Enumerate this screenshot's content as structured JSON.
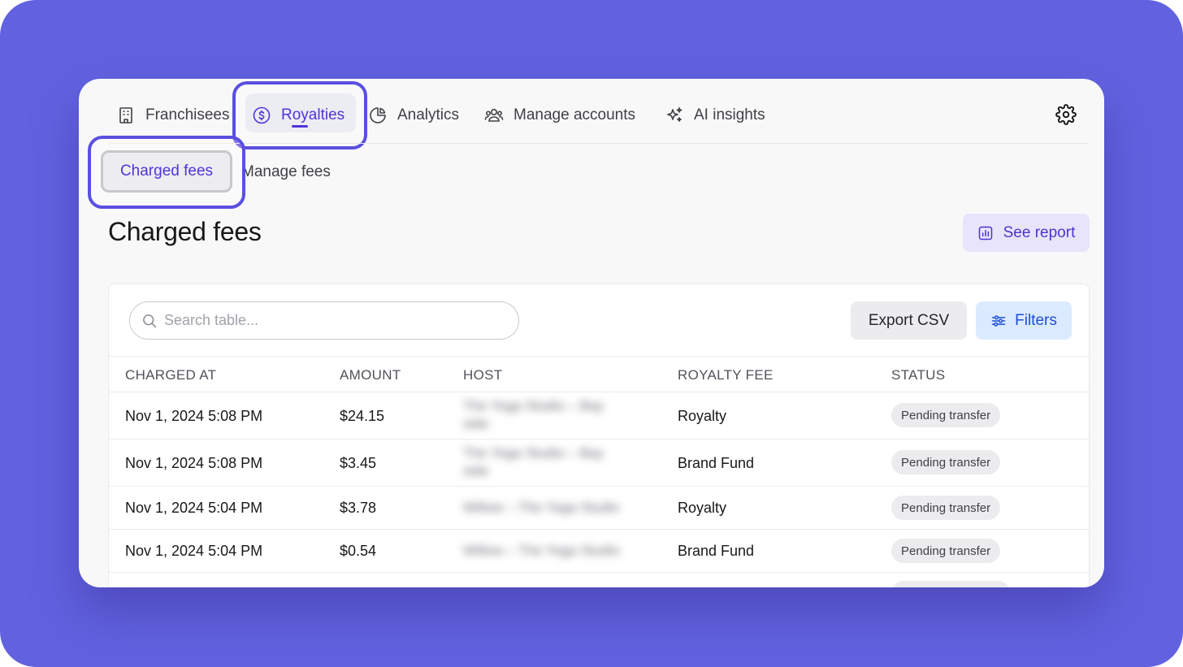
{
  "nav": {
    "items": [
      {
        "label": "Franchisees",
        "icon": "building-icon"
      },
      {
        "label": "Royalties",
        "icon": "dollar-circle-icon",
        "active": true
      },
      {
        "label": "Analytics",
        "icon": "pie-chart-icon"
      },
      {
        "label": "Manage accounts",
        "icon": "users-icon"
      },
      {
        "label": "AI insights",
        "icon": "sparkles-icon"
      }
    ],
    "settings_icon": "gear-icon"
  },
  "subnav": {
    "items": [
      {
        "label": "Charged fees",
        "active": true
      },
      {
        "label": "Manage fees"
      }
    ]
  },
  "page": {
    "title": "Charged fees",
    "see_report_label": "See report",
    "see_report_icon": "bar-chart-icon"
  },
  "toolbar": {
    "search_placeholder": "Search table...",
    "export_label": "Export CSV",
    "filters_label": "Filters",
    "filters_icon": "sliders-icon"
  },
  "table": {
    "columns": [
      "CHARGED AT",
      "AMOUNT",
      "HOST",
      "ROYALTY FEE",
      "STATUS"
    ],
    "rows": [
      {
        "charged_at": "Nov 1, 2024 5:08 PM",
        "amount": "$24.15",
        "host": "The Yoga Studio – Bay\nside",
        "royalty_fee": "Royalty",
        "status": "Pending transfer"
      },
      {
        "charged_at": "Nov 1, 2024 5:08 PM",
        "amount": "$3.45",
        "host": "The Yoga Studio – Bay\nside",
        "royalty_fee": "Brand Fund",
        "status": "Pending transfer"
      },
      {
        "charged_at": "Nov 1, 2024 5:04 PM",
        "amount": "$3.78",
        "host": "Willow – The Yoga Studio",
        "royalty_fee": "Royalty",
        "status": "Pending transfer"
      },
      {
        "charged_at": "Nov 1, 2024 5:04 PM",
        "amount": "$0.54",
        "host": "Willow – The Yoga Studio",
        "royalty_fee": "Brand Fund",
        "status": "Pending transfer"
      }
    ]
  },
  "colors": {
    "background": "#6262e0",
    "accent": "#4f35d9",
    "highlight_outline": "#5b4fe0"
  }
}
